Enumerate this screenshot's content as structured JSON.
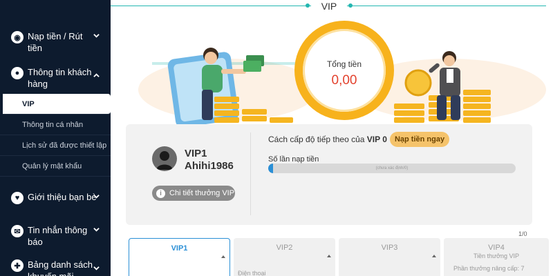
{
  "sidebar": {
    "items": [
      {
        "label": "Nạp tiền / Rút tiền",
        "icon": "eye-icon",
        "expanded": false
      },
      {
        "label": "Thông tin khách hàng",
        "icon": "person-icon",
        "expanded": true
      },
      {
        "label": "Giới thiệu bạn bè",
        "icon": "heart-icon",
        "expanded": false
      },
      {
        "label": "Tin nhắn thông báo",
        "icon": "envelope-icon",
        "expanded": false
      },
      {
        "label": "Bảng danh sách khuyến mãi",
        "icon": "gift-icon",
        "expanded": false
      }
    ],
    "subitems": [
      {
        "label": "VIP",
        "active": true
      },
      {
        "label": "Thông tin cá nhân",
        "active": false
      },
      {
        "label": "Lịch sử đã được thiết lập",
        "active": false
      },
      {
        "label": "Quản lý mật khẩu",
        "active": false
      }
    ]
  },
  "page": {
    "title": "VIP"
  },
  "hero": {
    "total_label": "Tổng tiền",
    "total_value": "0,00"
  },
  "profile": {
    "vip_level": "VIP1",
    "username": "Ahihi1986",
    "detail_button": "Chi tiết thưởng VIP"
  },
  "progress": {
    "next_level_text": "Cách cấp độ tiếp theo của",
    "next_level_value": "VIP 0",
    "deposit_button": "Nạp tiền ngay",
    "count_label": "Số lần nạp tiền",
    "bar_text": "(chưa xác định/0)",
    "fill_fraction": 0.02
  },
  "tiers": {
    "pager": "1/0",
    "cards": [
      {
        "name": "VIP1",
        "active": true,
        "rows": []
      },
      {
        "name": "VIP2",
        "active": false,
        "rows": [
          "Điện thoại"
        ]
      },
      {
        "name": "VIP3",
        "active": false,
        "rows": []
      },
      {
        "name": "VIP4",
        "active": false,
        "rows": [
          "Tiền thưởng VIP",
          "Phần thưởng nâng cấp: 7"
        ]
      }
    ]
  },
  "colors": {
    "sidebar_bg": "#0d1b2e",
    "accent": "#23b6b0",
    "gold": "#f7b21c",
    "amount": "#e3422e",
    "vip_active": "#2a8fd6"
  }
}
